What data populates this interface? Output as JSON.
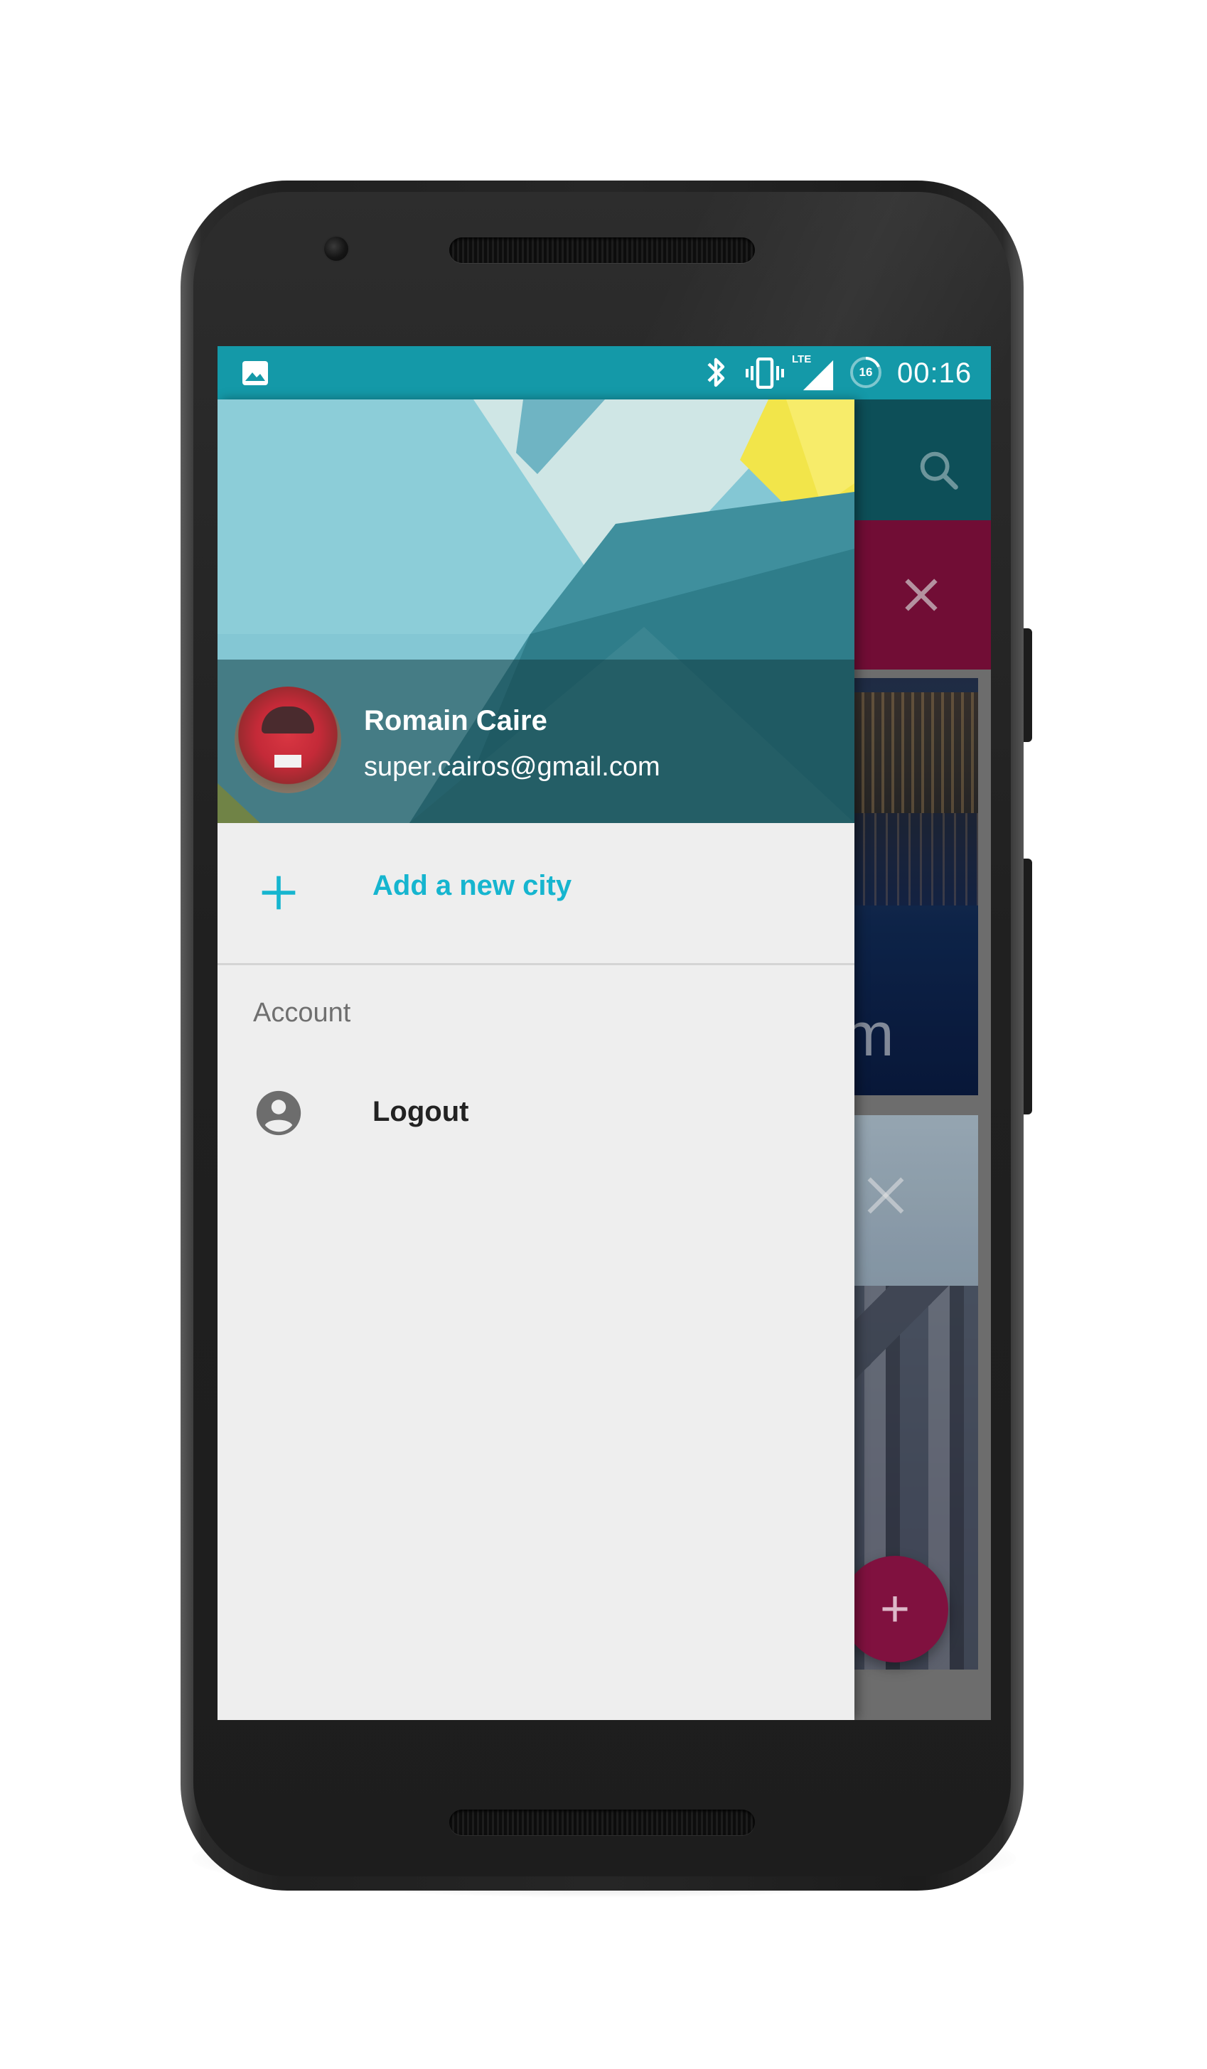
{
  "status_bar": {
    "time": "00:16",
    "lte_label": "LTE",
    "battery_level": "16",
    "icons": [
      "image-icon",
      "bluetooth-icon",
      "vibrate-icon",
      "lte-signal-icon",
      "battery-saver-icon"
    ]
  },
  "drawer": {
    "profile": {
      "name": "Romain Caire",
      "email": "super.cairos@gmail.com"
    },
    "add_city_label": "Add a new city",
    "section_account": "Account",
    "logout_label": "Logout"
  },
  "background_app": {
    "card_partial_text": "m"
  },
  "colors": {
    "status_bar": "#1499a8",
    "accent": "#16b5cf",
    "toolbar": "#0f5863",
    "secondary_bar": "#7e0f3b",
    "fab": "#8f1447",
    "drawer_bg": "#eeeeee"
  }
}
